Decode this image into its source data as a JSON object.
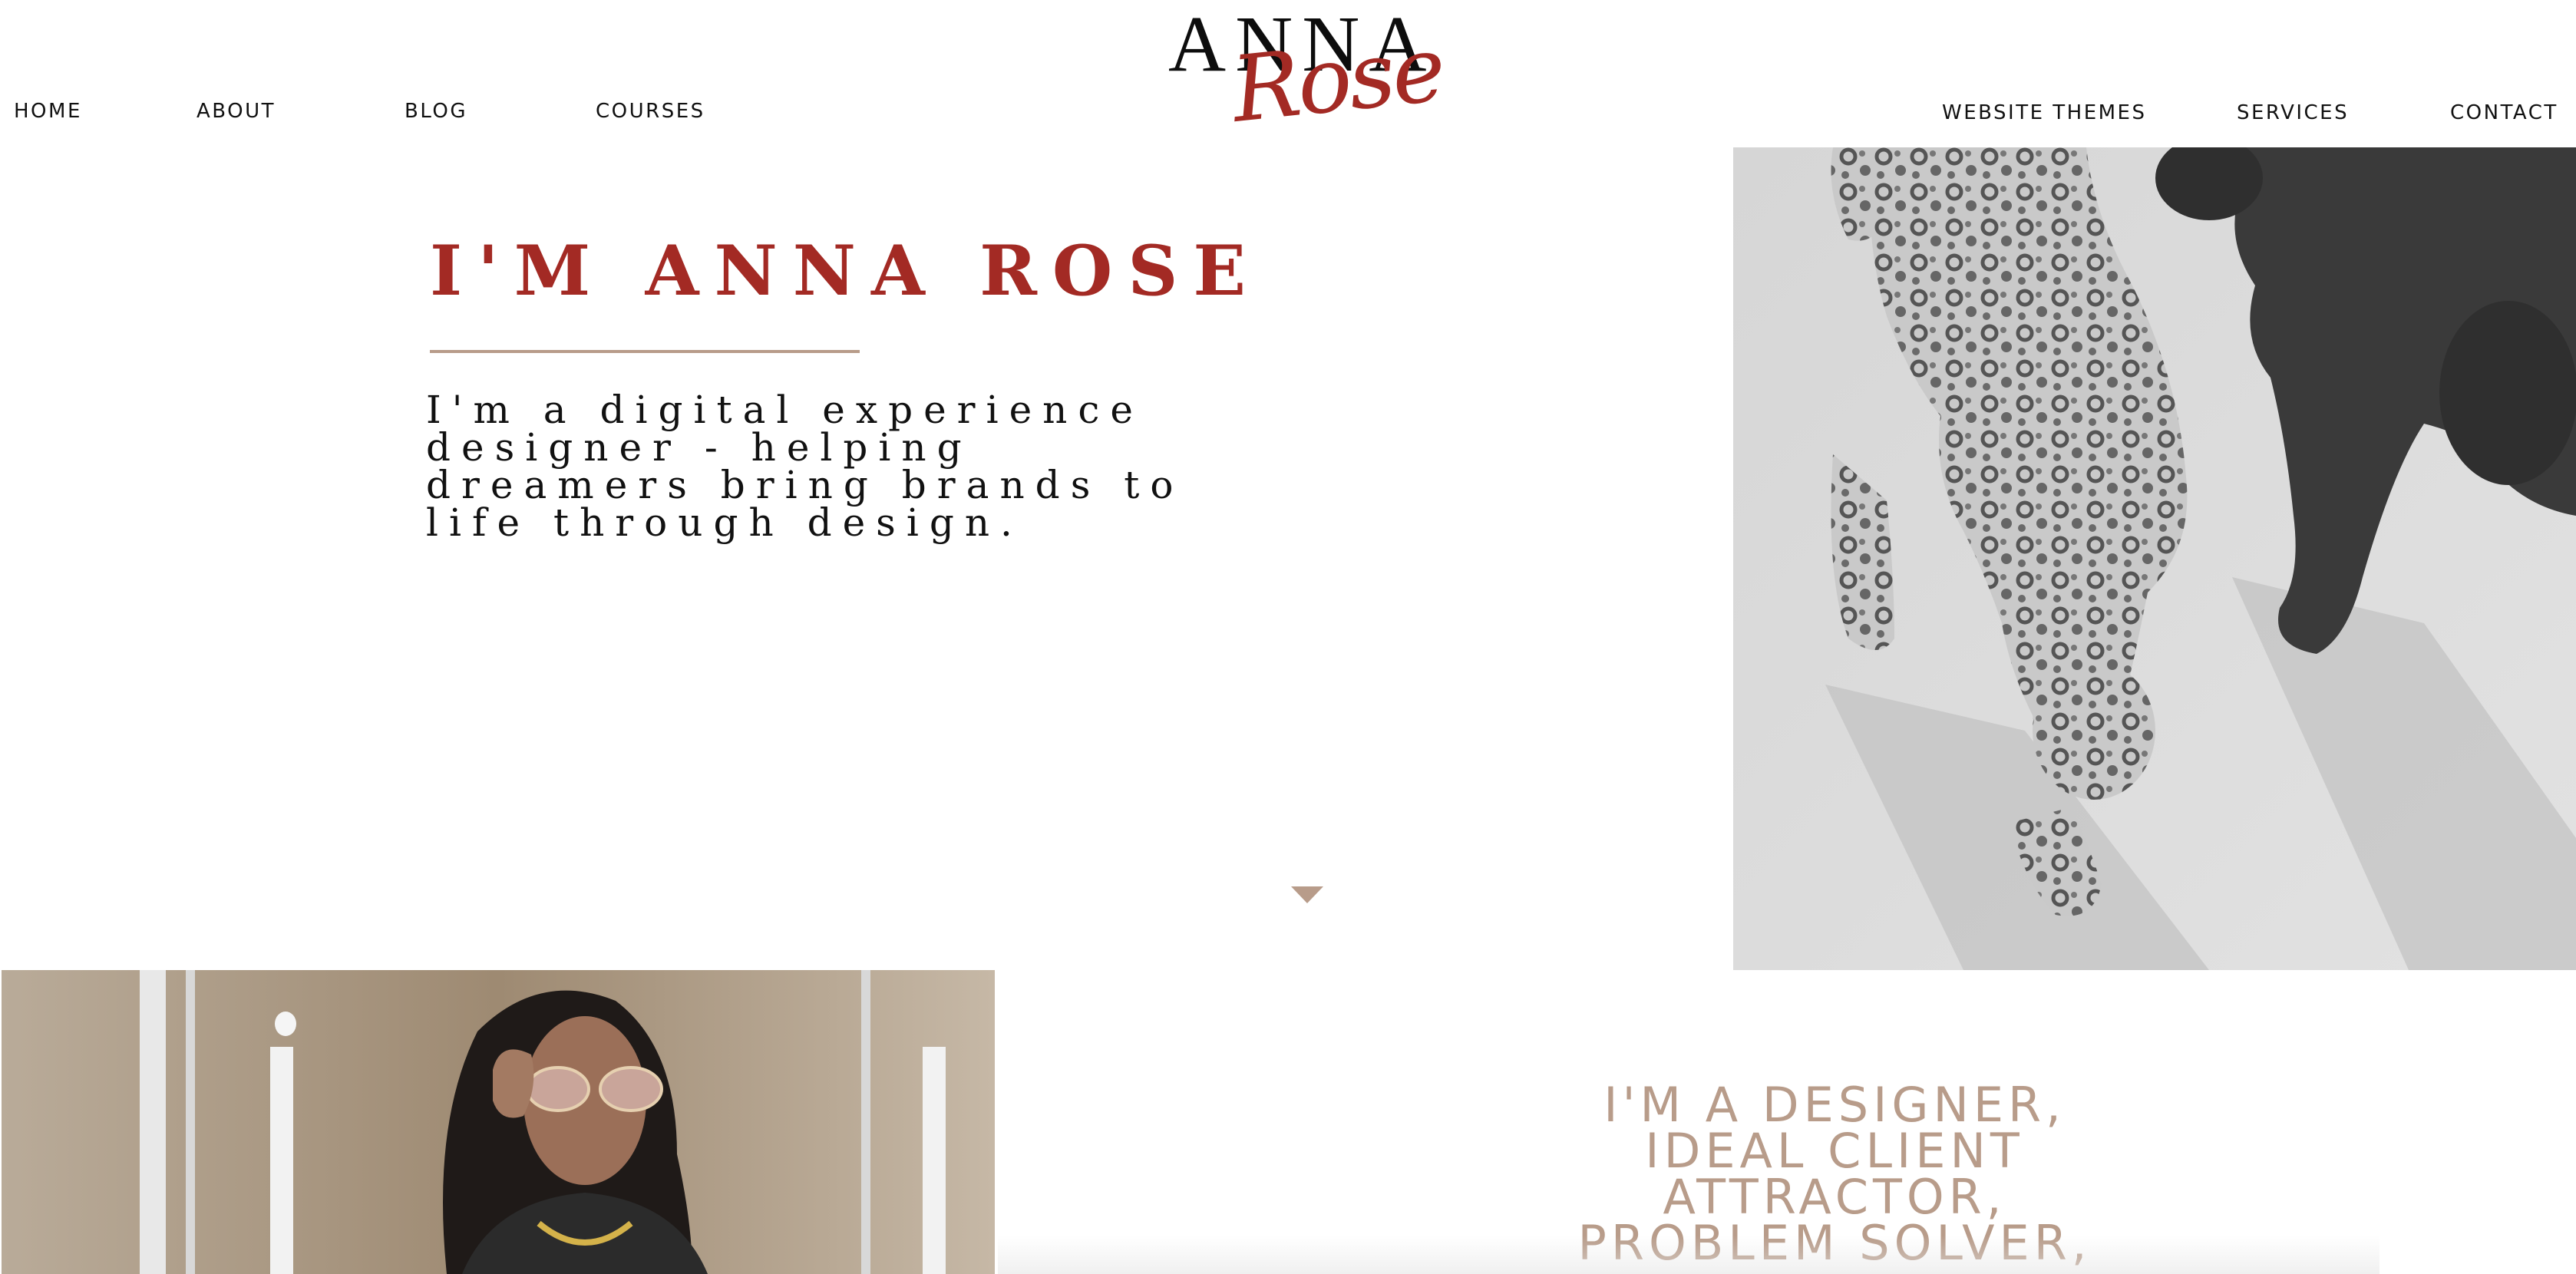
{
  "nav": {
    "left": [
      "HOME",
      "ABOUT",
      "BLOG",
      "COURSES"
    ],
    "right": [
      "WEBSITE THEMES",
      "SERVICES",
      "CONTACT"
    ]
  },
  "logo": {
    "top": "ANNA",
    "script": "Rose"
  },
  "hero": {
    "title": "I'M ANNA ROSE",
    "intro": "I'm a digital experience designer - helping dreamers bring brands to life through design."
  },
  "section": {
    "heading_lines": [
      "I'M A DESIGNER,",
      "IDEAL CLIENT",
      "ATTRACTOR,",
      "PROBLEM SOLVER,"
    ]
  },
  "colors": {
    "accent": "#a32a24",
    "tan": "#b89c8a",
    "text": "#111111",
    "background": "#ffffff"
  },
  "icons": {
    "scroll": "chevron-down-icon"
  }
}
